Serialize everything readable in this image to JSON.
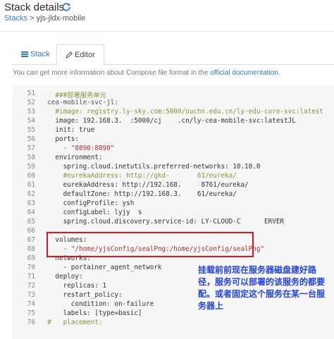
{
  "page": {
    "title": "Stack details",
    "breadcrumb_link": "Stacks",
    "breadcrumb_sep": " > ",
    "breadcrumb_current": "yjs-jldx-mobile"
  },
  "tabs": [
    {
      "label": "Stack"
    },
    {
      "label": "Editor"
    }
  ],
  "info": {
    "text": "You can get more information about Compose file format in the ",
    "link": "official documentation",
    "suffix": "."
  },
  "code_lines": [
    {
      "n": "51",
      "text": "    ###部署服务单元",
      "cls": "comment"
    },
    {
      "n": "52",
      "text": "  cea-mobile-svc-jl:",
      "cls": "key"
    },
    {
      "n": "53",
      "text": "    #image: registry.ly-sky.com:5000/ouchn.edu.cn/ly-edu-core-svc:latest",
      "cls": "comment"
    },
    {
      "n": "54",
      "text": "    image: 192.168.3.  :5000/cj    .cn/ly-cea-mobile-svc:latestJL",
      "cls": ""
    },
    {
      "n": "55",
      "text": "    init: true",
      "cls": ""
    },
    {
      "n": "56",
      "text": "    ports:",
      "cls": ""
    },
    {
      "n": "57",
      "text": "      - \"8890:8890\"",
      "cls": "str"
    },
    {
      "n": "58",
      "text": "    environment:",
      "cls": ""
    },
    {
      "n": "59",
      "text": "      spring.cloud.inetutils.preferred-networks: 10.10.0",
      "cls": ""
    },
    {
      "n": "60",
      "text": "      #eurekaAddress: http://gkd-       61/eureka/",
      "cls": "comment"
    },
    {
      "n": "61",
      "text": "      eurekaAddress: http://192.168.     8761/eureka/",
      "cls": ""
    },
    {
      "n": "62",
      "text": "      defaultZone: http://192.168.3.    61/eureka/",
      "cls": ""
    },
    {
      "n": "63",
      "text": "      configProfile: ysh",
      "cls": ""
    },
    {
      "n": "64",
      "text": "      configLabel: lyjy  s",
      "cls": ""
    },
    {
      "n": "65",
      "text": "      spring.cloud.discovery.service-id: LY-CLOUD-C      ERVER",
      "cls": ""
    },
    {
      "n": "66",
      "text": "",
      "cls": ""
    },
    {
      "n": "67",
      "text": "    volumes:",
      "cls": ""
    },
    {
      "n": "68",
      "text": "      - \"/home/yjsConfig/sealPng:/home/yjsConfig/sealPng\"",
      "cls": "str"
    },
    {
      "n": "69",
      "text": "    networks:",
      "cls": ""
    },
    {
      "n": "70",
      "text": "      - portainer_agent_network",
      "cls": ""
    },
    {
      "n": "71",
      "text": "    deploy:",
      "cls": ""
    },
    {
      "n": "72",
      "text": "      replicas: 1",
      "cls": ""
    },
    {
      "n": "73",
      "text": "      restart_policy:",
      "cls": ""
    },
    {
      "n": "74",
      "text": "        condition: on-failure",
      "cls": ""
    },
    {
      "n": "75",
      "text": "      labels: [type=basic]",
      "cls": ""
    },
    {
      "n": "76",
      "text": "  #   placement:",
      "cls": "comment"
    }
  ],
  "annotation": "挂载前前现在服务器磁盘建好路径，服务可以部署的该服务的都要配。或者固定这个服务在某一台服务器上",
  "colors": {
    "accent": "#337ab7",
    "highlight_box": "#e0141e",
    "annotation": "#2244dd"
  }
}
